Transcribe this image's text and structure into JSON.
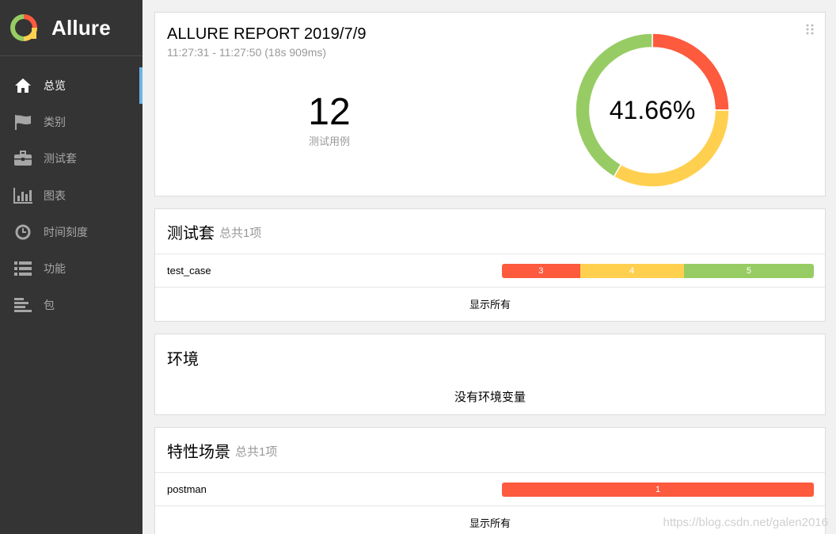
{
  "brand": {
    "name": "Allure"
  },
  "sidebar": {
    "items": [
      {
        "label": "总览",
        "icon": "home-icon",
        "active": true
      },
      {
        "label": "类别",
        "icon": "flag-icon",
        "active": false
      },
      {
        "label": "测试套",
        "icon": "briefcase-icon",
        "active": false
      },
      {
        "label": "图表",
        "icon": "bar-chart-icon",
        "active": false
      },
      {
        "label": "时间刻度",
        "icon": "clock-icon",
        "active": false
      },
      {
        "label": "功能",
        "icon": "list-icon",
        "active": false
      },
      {
        "label": "包",
        "icon": "align-left-icon",
        "active": false
      }
    ]
  },
  "summary": {
    "title": "ALLURE REPORT 2019/7/9",
    "time": "11:27:31 - 11:27:50 (18s 909ms)",
    "count": "12",
    "count_label": "测试用例",
    "percent": "41.66%",
    "donut": {
      "failed": 3,
      "broken": 4,
      "passed": 5
    }
  },
  "colors": {
    "failed": "#fd5a3e",
    "broken": "#ffd050",
    "passed": "#97cc64",
    "sidebar_bg": "#343434",
    "active_accent": "#6eb4e5"
  },
  "suites": {
    "title": "测试套",
    "subtitle": "总共1项",
    "rows": [
      {
        "name": "test_case",
        "failed": 3,
        "broken": 4,
        "passed": 5
      }
    ],
    "show_all": "显示所有"
  },
  "environment": {
    "title": "环境",
    "empty": "没有环境变量"
  },
  "features": {
    "title": "特性场景",
    "subtitle": "总共1项",
    "rows": [
      {
        "name": "postman",
        "failed": 1,
        "broken": 0,
        "passed": 0
      }
    ],
    "show_all": "显示所有"
  },
  "watermark": "https://blog.csdn.net/galen2016"
}
